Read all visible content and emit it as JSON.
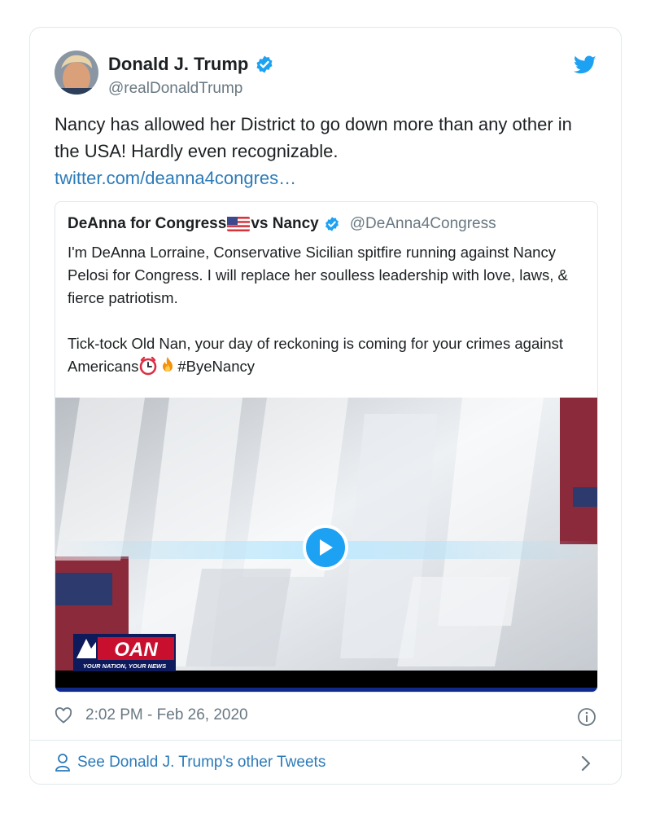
{
  "tweet": {
    "author_name": "Donald J. Trump",
    "author_handle": "@realDonaldTrump",
    "text": "Nancy has allowed her District to go down more than any other in the USA! Hardly even recognizable.",
    "link_text": "twitter.com/deanna4congres…",
    "timestamp": "2:02 PM - Feb 26, 2020",
    "icons": {
      "verified": "verified-badge-icon",
      "brand": "twitter-bird-icon",
      "like": "heart-icon",
      "info": "info-icon",
      "person": "person-icon",
      "chevron": "chevron-right-icon"
    }
  },
  "quoted_tweet": {
    "author_name_part1": "DeAnna for Congress",
    "author_name_part2": "vs Nancy",
    "author_handle": "@DeAnna4Congress",
    "paragraph1": "I'm DeAnna Lorraine, Conservative Sicilian spitfire running against Nancy Pelosi for Congress. I will replace her soulless leadership with love, laws, & fierce patriotism.",
    "paragraph2_start": "Tick-tock Old Nan, your day of reckoning is coming for your crimes against Americans",
    "hashtag": "#ByeNancy",
    "emoji": [
      "alarm-clock-emoji",
      "fire-emoji"
    ],
    "video": {
      "logo_text": "OAN",
      "logo_tagline": "YOUR NATION, YOUR NEWS",
      "play_icon": "play-icon"
    }
  },
  "footer": {
    "see_more_label": "See Donald J. Trump's other Tweets"
  },
  "colors": {
    "link": "#2b7bb9",
    "verified": "#1da1f2",
    "muted_text": "#697882",
    "border": "#e1e8ed"
  }
}
